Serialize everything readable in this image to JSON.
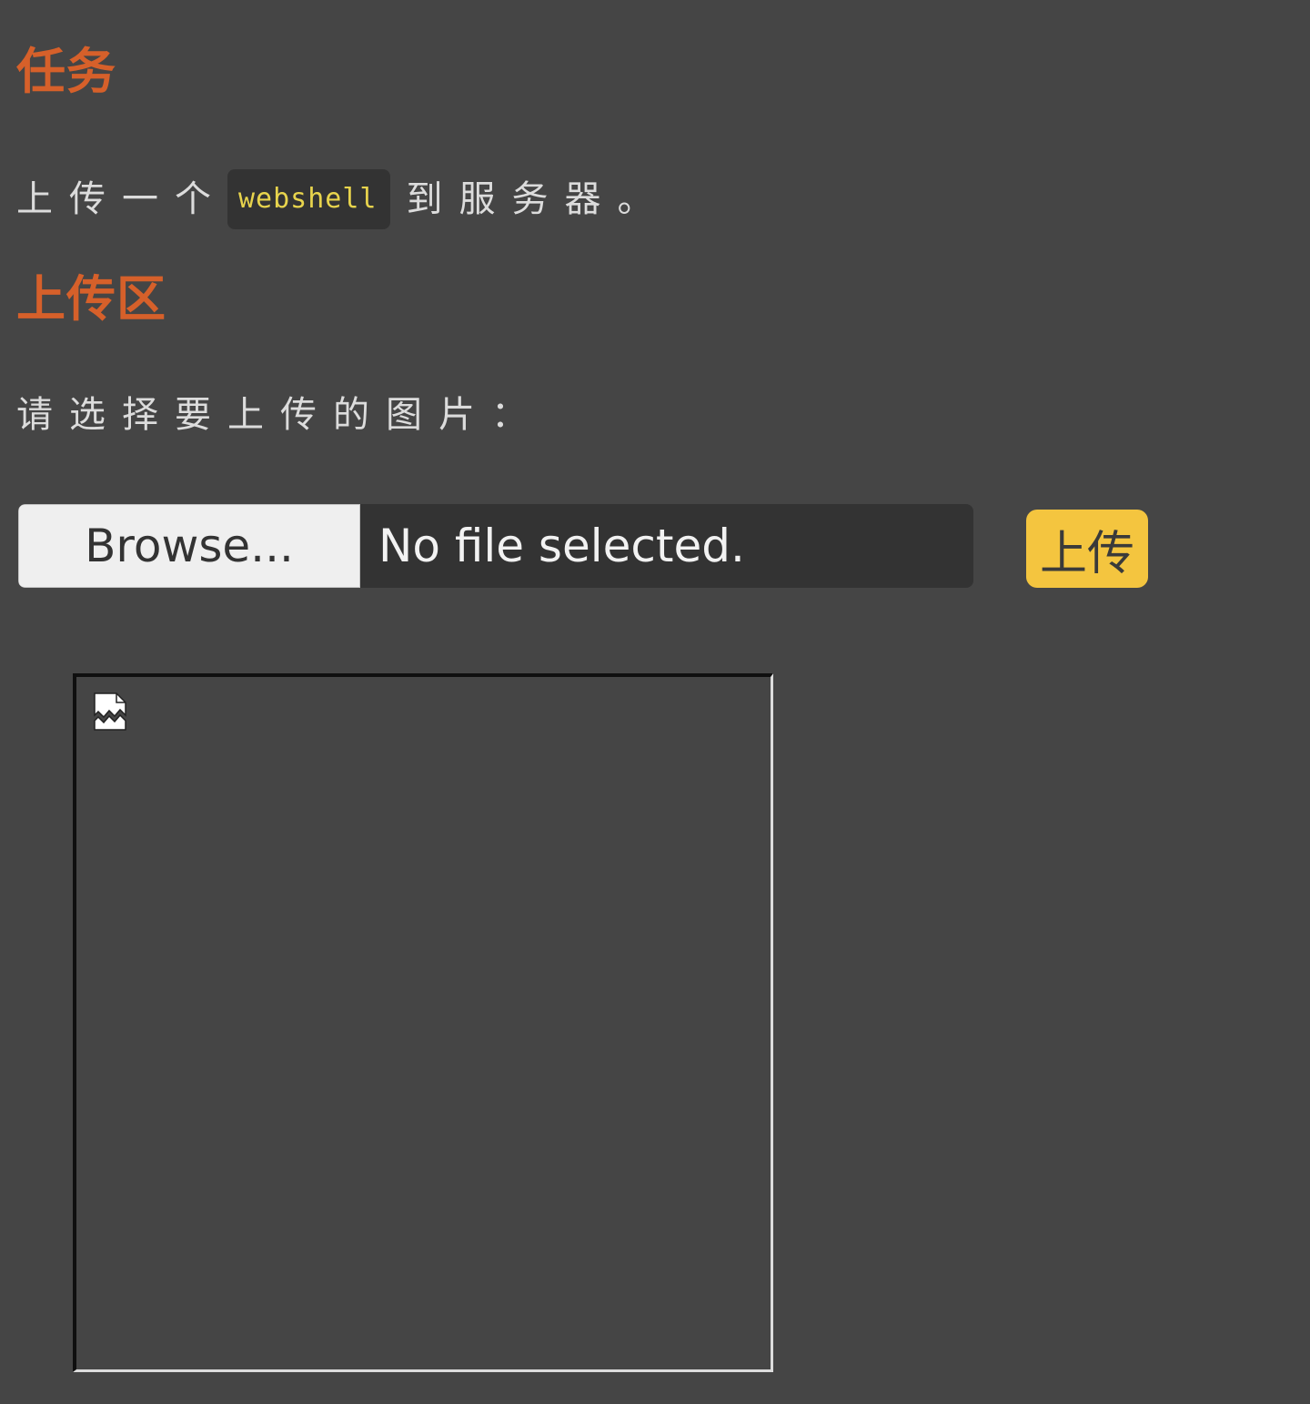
{
  "task": {
    "heading": "任务",
    "text_before": "上传一个",
    "code": "webshell",
    "text_after": "到服务器。"
  },
  "upload_area": {
    "heading": "上传区",
    "prompt": "请选择要上传的图片：",
    "browse_label": "Browse...",
    "file_status": "No file selected.",
    "submit_label": "上传"
  },
  "preview": {
    "icon": "broken-image-icon"
  },
  "colors": {
    "background": "#454545",
    "heading": "#d6602a",
    "code_text": "#e8d44d",
    "submit_button": "#f4c53f"
  }
}
